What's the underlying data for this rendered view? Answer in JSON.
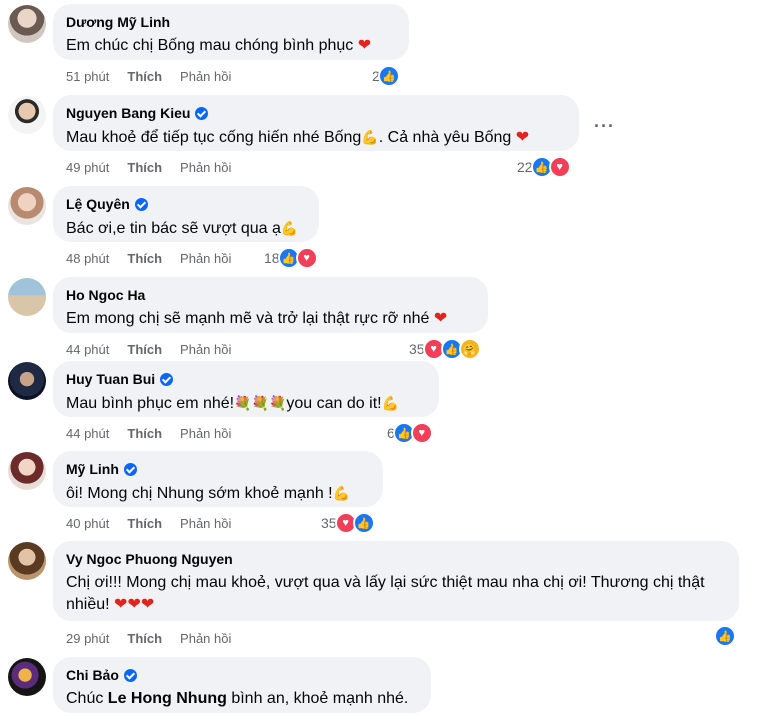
{
  "comments": [
    {
      "name": "Dương Mỹ Linh",
      "verified": false,
      "text": "Em chúc chị Bống mau chóng bình phục",
      "time": "51 phút",
      "like": "Thích",
      "reply": "Phản hồi",
      "count": "2"
    },
    {
      "name": "Nguyen Bang Kieu",
      "verified": true,
      "text": "Mau khoẻ để tiếp tục cống hiến nhé Bống",
      "text2": ". Cả nhà yêu Bống",
      "time": "49 phút",
      "like": "Thích",
      "reply": "Phản hồi",
      "count": "22"
    },
    {
      "name": "Lệ Quyên",
      "verified": true,
      "text": "Bác ơi,e tin bác sẽ vượt qua ạ",
      "time": "48 phút",
      "like": "Thích",
      "reply": "Phản hồi",
      "count": "18"
    },
    {
      "name": "Ho Ngoc Ha",
      "verified": false,
      "text": "Em mong chị sẽ mạnh mẽ và trở lại thật rực rỡ nhé",
      "time": "44 phút",
      "like": "Thích",
      "reply": "Phản hồi",
      "count": "35"
    },
    {
      "name": "Huy Tuan Bui",
      "verified": true,
      "text": "Mau bình phục em nhé!",
      "text2": "you can do it!",
      "time": "44 phút",
      "like": "Thích",
      "reply": "Phản hồi",
      "count": "6"
    },
    {
      "name": "Mỹ Linh",
      "verified": true,
      "text": "ôi! Mong chị Nhung sớm khoẻ mạnh !",
      "time": "40 phút",
      "like": "Thích",
      "reply": "Phản hồi",
      "count": "35"
    },
    {
      "name": "Vy Ngoc Phuong Nguyen",
      "verified": false,
      "text": "Chị ơi!!! Mong chị mau khoẻ, vượt qua và lấy lại sức thiệt mau nha chị ơi! Thương chị thật nhiều!",
      "time": "29 phút",
      "like": "Thích",
      "reply": "Phản hồi",
      "count": ""
    },
    {
      "name": "Chi Bảo",
      "verified": true,
      "text_pre": "Chúc ",
      "mention": "Le Hong Nhung",
      "text_post": " bình an, khoẻ mạnh nhé."
    }
  ],
  "more_label": "···",
  "colors": {
    "like": "#1877f2",
    "love": "#f33e58",
    "bubble": "#f0f2f5",
    "meta": "#65676b",
    "verified": "#0866ff"
  }
}
